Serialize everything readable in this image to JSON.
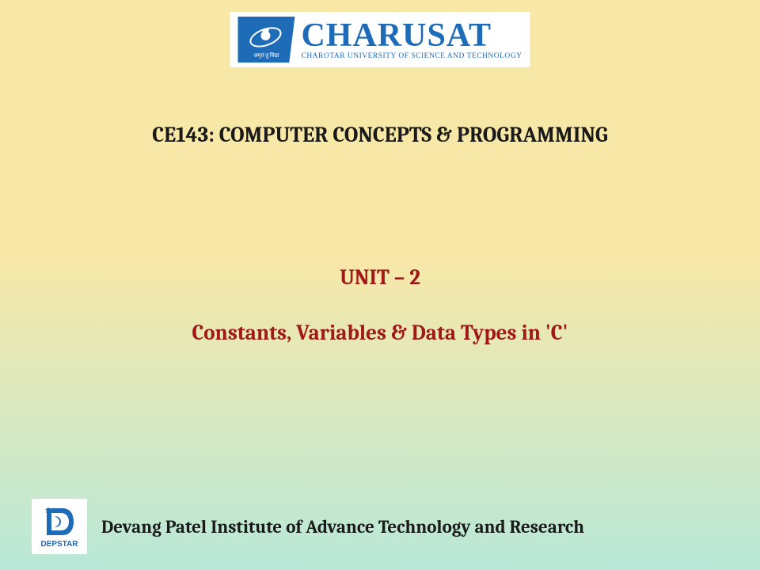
{
  "logo": {
    "name": "CHARUSAT",
    "subtitle": "CHAROTAR UNIVERSITY OF SCIENCE AND TECHNOLOGY",
    "motto": "अमृतं तु विद्या"
  },
  "course_title": "CE143: COMPUTER CONCEPTS & PROGRAMMING",
  "unit_label": "UNIT – 2",
  "unit_title": "Constants, Variables & Data Types in 'C'",
  "footer": {
    "logo_text": "DEPSTAR",
    "institute": "Devang Patel Institute of Advance Technology and Research"
  }
}
